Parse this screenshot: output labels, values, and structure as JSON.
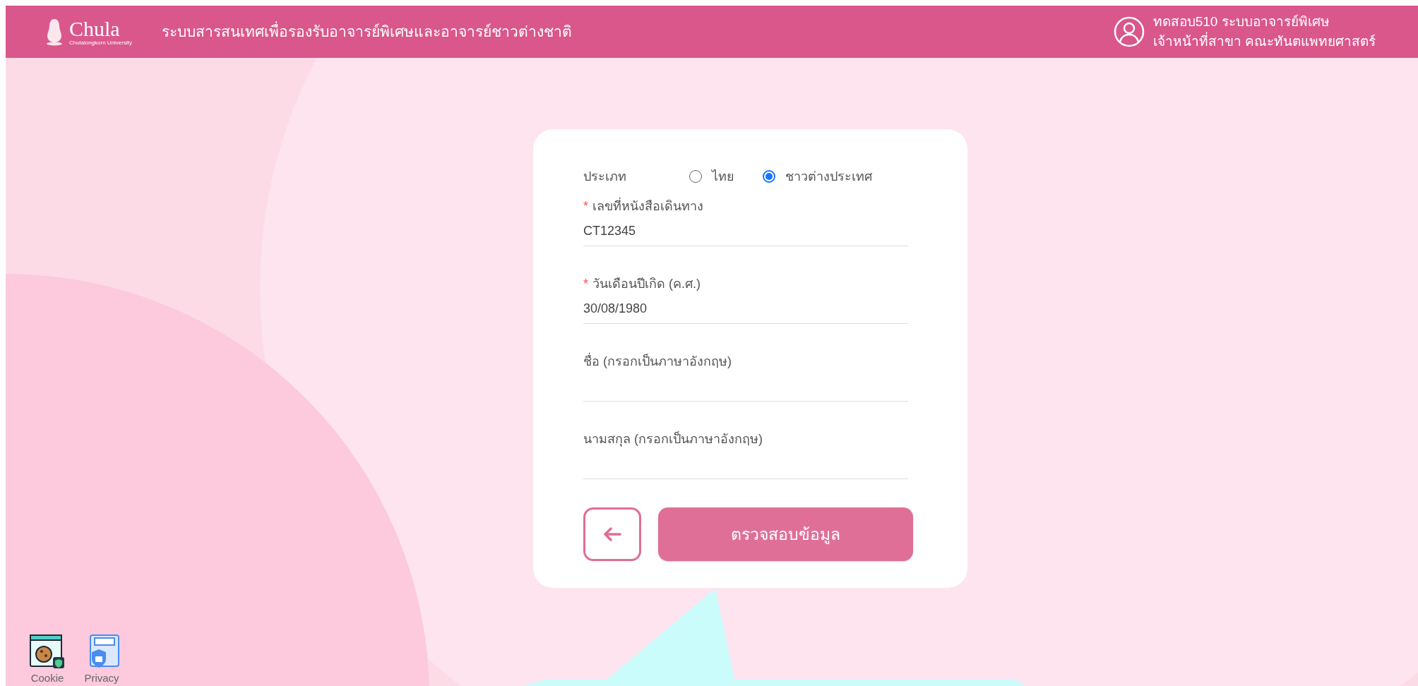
{
  "header": {
    "logo_text": "Chula",
    "logo_subtext": "Chulalongkorn University",
    "title": "ระบบสารสนเทศเพื่อรองรับอาจารย์พิเศษและอาจารย์ชาวต่างชาติ",
    "user": {
      "name": "ทดสอบ510 ระบบอาจารย์พิเศษ",
      "role": "เจ้าหน้าที่สาขา คณะทันตแพทยศาสตร์"
    }
  },
  "form": {
    "type_label": "ประเภท",
    "type_options": [
      {
        "label": "ไทย",
        "selected": false
      },
      {
        "label": "ชาวต่างประเทศ",
        "selected": true
      }
    ],
    "fields": [
      {
        "required_mark": "*",
        "label": "เลขที่หนังสือเดินทาง",
        "value": "CT12345"
      },
      {
        "required_mark": "*",
        "label": "วันเดือนปีเกิด (ค.ศ.)",
        "value": "30/08/1980"
      },
      {
        "label": "ชื่อ (กรอกเป็นภาษาอังกฤษ)"
      },
      {
        "label": "นามสกุล (กรอกเป็นภาษาอังกฤษ)"
      }
    ],
    "submit_button": "ตรวจสอบข้อมูล"
  },
  "footer_links": [
    {
      "kind": "cookie",
      "label": "Cookie"
    },
    {
      "kind": "privacy",
      "label": "Privacy"
    }
  ]
}
